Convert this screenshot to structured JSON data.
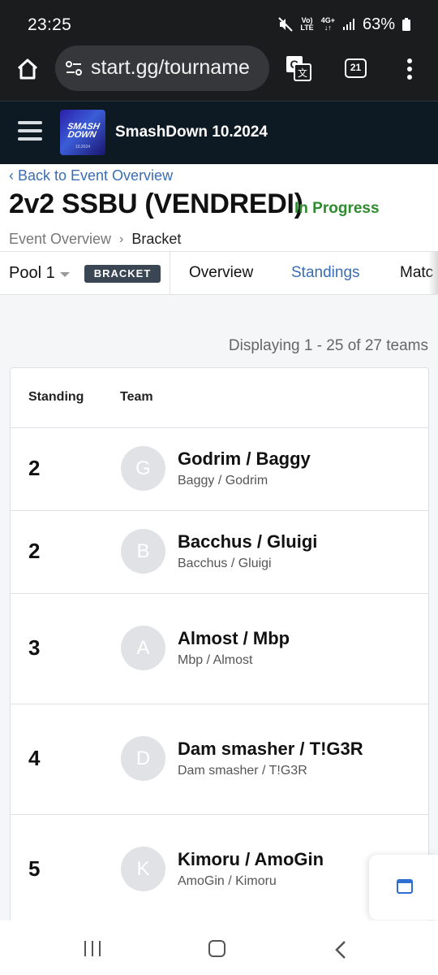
{
  "status_bar": {
    "time": "23:25",
    "network_top": "Vo)",
    "network_bottom": "LTE",
    "network2_top": "4G+",
    "battery": "63%"
  },
  "browser": {
    "url": "start.gg/tourname",
    "tab_count": "21",
    "icons": [
      "home-icon",
      "site-settings-icon",
      "translate-icon",
      "tab-switcher-icon",
      "more-vertical-icon"
    ]
  },
  "site_header": {
    "tournament_name": "SmashDown 10.2024",
    "logo_text": "SMASH DOWN",
    "logo_sub": "10.2024"
  },
  "page": {
    "back_link": "‹ Back to Event Overview",
    "event_title": "2v2 SSBU (VENDREDI)",
    "event_status": "In Progress",
    "status_color": "#2e8b2e",
    "breadcrumb": [
      {
        "label": "Event Overview"
      },
      {
        "label": "Bracket"
      }
    ],
    "breadcrumb_sep": "›"
  },
  "tabs": {
    "pool": "Pool 1",
    "bracket_badge": "BRACKET",
    "overview": "Overview",
    "standings": "Standings",
    "matches": "Matc"
  },
  "standings": {
    "displaying": "Displaying 1 - 25 of 27 teams",
    "headers": {
      "standing": "Standing",
      "team": "Team"
    },
    "rows": [
      {
        "rank": "2",
        "initial": "G",
        "name": "Godrim / Baggy",
        "sub": "Baggy / Godrim"
      },
      {
        "rank": "2",
        "initial": "B",
        "name": "Bacchus / Gluigi",
        "sub": "Bacchus / Gluigi"
      },
      {
        "rank": "3",
        "initial": "A",
        "name": "Almost / Mbp",
        "sub": "Mbp / Almost"
      },
      {
        "rank": "4",
        "initial": "D",
        "name": "Dam smasher / T!G3R",
        "sub": "Dam smasher / T!G3R"
      },
      {
        "rank": "5",
        "initial": "K",
        "name": "Kimoru / AmoGin",
        "sub": "AmoGin / Kimoru"
      }
    ]
  },
  "colors": {
    "link": "#3a6db5",
    "header_bg": "#0d1a24",
    "accent_blue": "#2f6fcf"
  }
}
